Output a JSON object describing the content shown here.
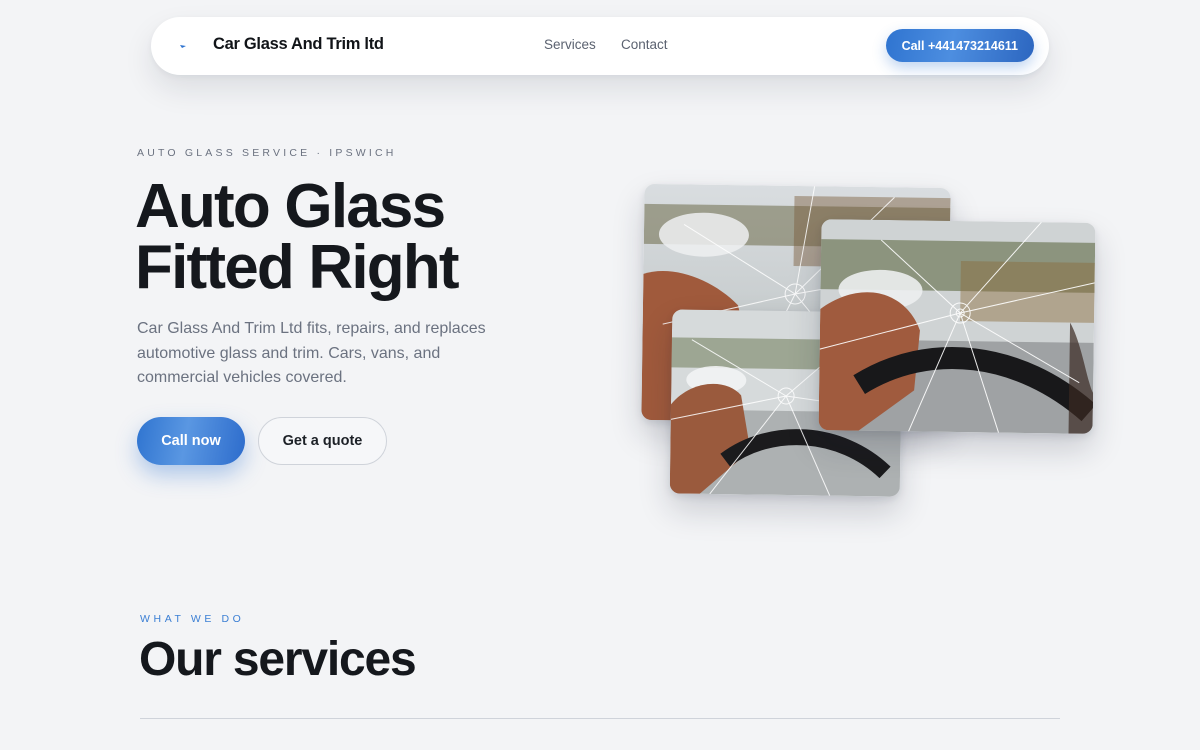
{
  "nav": {
    "brand_name": "Car Glass And Trim ltd",
    "links": [
      "Services",
      "Contact"
    ],
    "call_label": "Call +441473214611"
  },
  "hero": {
    "eyebrow": "AUTO GLASS SERVICE · IPSWICH",
    "title_line1": "Auto Glass",
    "title_line2": "Fitted Right",
    "description": "Car Glass And Trim Ltd fits, repairs, and replaces automotive glass and trim. Cars, vans, and commercial vehicles covered.",
    "primary_button": "Call now",
    "secondary_button": "Get a quote"
  },
  "services": {
    "eyebrow": "WHAT WE DO",
    "title": "Our services"
  },
  "colors": {
    "accent": "#2f74d0",
    "background": "#f3f4f6",
    "heading": "#15181d",
    "muted": "#6b7280"
  },
  "icons": {
    "brand": "brand-logo-icon"
  }
}
